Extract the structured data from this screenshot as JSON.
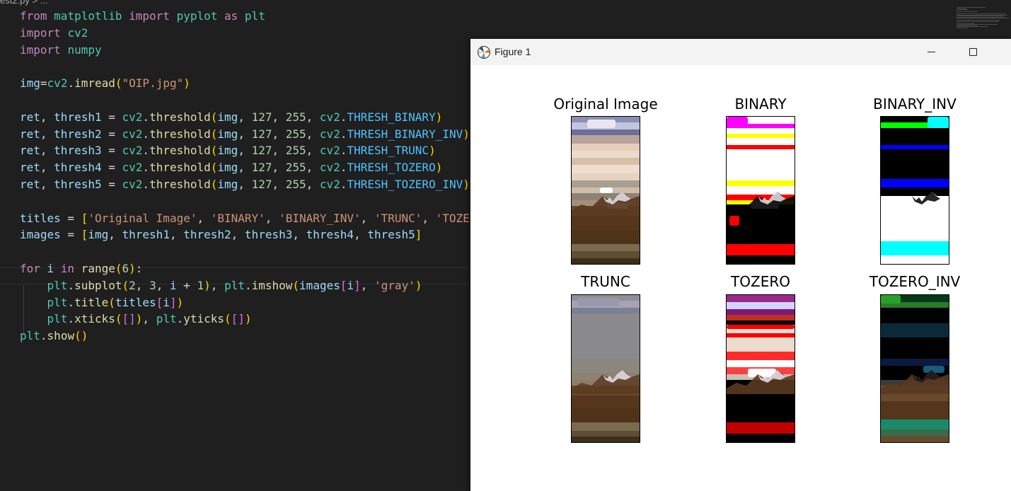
{
  "editor": {
    "breadcrumb": "est2.py > ...",
    "lines": [
      [
        [
          "kw",
          "from "
        ],
        [
          "mod",
          "matplotlib "
        ],
        [
          "kw",
          "import "
        ],
        [
          "mod",
          "pyplot "
        ],
        [
          "kw",
          "as "
        ],
        [
          "mod",
          "plt"
        ]
      ],
      [
        [
          "kw",
          "import "
        ],
        [
          "mod",
          "cv2"
        ]
      ],
      [
        [
          "kw",
          "import "
        ],
        [
          "mod",
          "numpy"
        ]
      ],
      [],
      [
        [
          "var",
          "img"
        ],
        [
          "plain",
          "="
        ],
        [
          "mod",
          "cv2"
        ],
        [
          "plain",
          "."
        ],
        [
          "fn",
          "imread"
        ],
        [
          "br1",
          "("
        ],
        [
          "str",
          "\"OIP.jpg\""
        ],
        [
          "br1",
          ")"
        ]
      ],
      [],
      [
        [
          "var",
          "ret"
        ],
        [
          "plain",
          ", "
        ],
        [
          "var",
          "thresh1"
        ],
        [
          "plain",
          " = "
        ],
        [
          "mod",
          "cv2"
        ],
        [
          "plain",
          "."
        ],
        [
          "fn",
          "threshold"
        ],
        [
          "br1",
          "("
        ],
        [
          "var",
          "img"
        ],
        [
          "plain",
          ", "
        ],
        [
          "num",
          "127"
        ],
        [
          "plain",
          ", "
        ],
        [
          "num",
          "255"
        ],
        [
          "plain",
          ", "
        ],
        [
          "mod",
          "cv2"
        ],
        [
          "plain",
          "."
        ],
        [
          "const",
          "THRESH_BINARY"
        ],
        [
          "br1",
          ")"
        ]
      ],
      [
        [
          "var",
          "ret"
        ],
        [
          "plain",
          ", "
        ],
        [
          "var",
          "thresh2"
        ],
        [
          "plain",
          " = "
        ],
        [
          "mod",
          "cv2"
        ],
        [
          "plain",
          "."
        ],
        [
          "fn",
          "threshold"
        ],
        [
          "br1",
          "("
        ],
        [
          "var",
          "img"
        ],
        [
          "plain",
          ", "
        ],
        [
          "num",
          "127"
        ],
        [
          "plain",
          ", "
        ],
        [
          "num",
          "255"
        ],
        [
          "plain",
          ", "
        ],
        [
          "mod",
          "cv2"
        ],
        [
          "plain",
          "."
        ],
        [
          "const",
          "THRESH_BINARY_INV"
        ],
        [
          "br1",
          ")"
        ]
      ],
      [
        [
          "var",
          "ret"
        ],
        [
          "plain",
          ", "
        ],
        [
          "var",
          "thresh3"
        ],
        [
          "plain",
          " = "
        ],
        [
          "mod",
          "cv2"
        ],
        [
          "plain",
          "."
        ],
        [
          "fn",
          "threshold"
        ],
        [
          "br1",
          "("
        ],
        [
          "var",
          "img"
        ],
        [
          "plain",
          ", "
        ],
        [
          "num",
          "127"
        ],
        [
          "plain",
          ", "
        ],
        [
          "num",
          "255"
        ],
        [
          "plain",
          ", "
        ],
        [
          "mod",
          "cv2"
        ],
        [
          "plain",
          "."
        ],
        [
          "const",
          "THRESH_TRUNC"
        ],
        [
          "br1",
          ")"
        ]
      ],
      [
        [
          "var",
          "ret"
        ],
        [
          "plain",
          ", "
        ],
        [
          "var",
          "thresh4"
        ],
        [
          "plain",
          " = "
        ],
        [
          "mod",
          "cv2"
        ],
        [
          "plain",
          "."
        ],
        [
          "fn",
          "threshold"
        ],
        [
          "br1",
          "("
        ],
        [
          "var",
          "img"
        ],
        [
          "plain",
          ", "
        ],
        [
          "num",
          "127"
        ],
        [
          "plain",
          ", "
        ],
        [
          "num",
          "255"
        ],
        [
          "plain",
          ", "
        ],
        [
          "mod",
          "cv2"
        ],
        [
          "plain",
          "."
        ],
        [
          "const",
          "THRESH_TOZERO"
        ],
        [
          "br1",
          ")"
        ]
      ],
      [
        [
          "var",
          "ret"
        ],
        [
          "plain",
          ", "
        ],
        [
          "var",
          "thresh5"
        ],
        [
          "plain",
          " = "
        ],
        [
          "mod",
          "cv2"
        ],
        [
          "plain",
          "."
        ],
        [
          "fn",
          "threshold"
        ],
        [
          "br1",
          "("
        ],
        [
          "var",
          "img"
        ],
        [
          "plain",
          ", "
        ],
        [
          "num",
          "127"
        ],
        [
          "plain",
          ", "
        ],
        [
          "num",
          "255"
        ],
        [
          "plain",
          ", "
        ],
        [
          "mod",
          "cv2"
        ],
        [
          "plain",
          "."
        ],
        [
          "const",
          "THRESH_TOZERO_INV"
        ],
        [
          "br1",
          ")"
        ]
      ],
      [],
      [
        [
          "var",
          "titles"
        ],
        [
          "plain",
          " = "
        ],
        [
          "br1",
          "["
        ],
        [
          "str",
          "'Original Image'"
        ],
        [
          "plain",
          ", "
        ],
        [
          "str",
          "'BINARY'"
        ],
        [
          "plain",
          ", "
        ],
        [
          "str",
          "'BINARY_INV'"
        ],
        [
          "plain",
          ", "
        ],
        [
          "str",
          "'TRUNC'"
        ],
        [
          "plain",
          ", "
        ],
        [
          "str",
          "'TOZE"
        ]
      ],
      [
        [
          "var",
          "images"
        ],
        [
          "plain",
          " = "
        ],
        [
          "br1",
          "["
        ],
        [
          "var",
          "img"
        ],
        [
          "plain",
          ", "
        ],
        [
          "var",
          "thresh1"
        ],
        [
          "plain",
          ", "
        ],
        [
          "var",
          "thresh2"
        ],
        [
          "plain",
          ", "
        ],
        [
          "var",
          "thresh3"
        ],
        [
          "plain",
          ", "
        ],
        [
          "var",
          "thresh4"
        ],
        [
          "plain",
          ", "
        ],
        [
          "var",
          "thresh5"
        ],
        [
          "br1",
          "]"
        ]
      ],
      [],
      [
        [
          "kw",
          "for "
        ],
        [
          "var",
          "i "
        ],
        [
          "kw",
          "in "
        ],
        [
          "fn",
          "range"
        ],
        [
          "br1",
          "("
        ],
        [
          "num",
          "6"
        ],
        [
          "br1",
          ")"
        ],
        [
          "plain",
          ":"
        ]
      ],
      [
        [
          "plain",
          "    "
        ],
        [
          "mod",
          "plt"
        ],
        [
          "plain",
          "."
        ],
        [
          "fn",
          "subplot"
        ],
        [
          "br1",
          "("
        ],
        [
          "num",
          "2"
        ],
        [
          "plain",
          ", "
        ],
        [
          "num",
          "3"
        ],
        [
          "plain",
          ", "
        ],
        [
          "var",
          "i"
        ],
        [
          "plain",
          " + "
        ],
        [
          "num",
          "1"
        ],
        [
          "br1",
          ")"
        ],
        [
          "plain",
          ", "
        ],
        [
          "mod",
          "plt"
        ],
        [
          "plain",
          "."
        ],
        [
          "fn",
          "imshow"
        ],
        [
          "br1",
          "("
        ],
        [
          "var",
          "images"
        ],
        [
          "br2",
          "["
        ],
        [
          "var",
          "i"
        ],
        [
          "br2",
          "]"
        ],
        [
          "plain",
          ", "
        ],
        [
          "str",
          "'gray'"
        ],
        [
          "br1",
          ")"
        ]
      ],
      [
        [
          "plain",
          "    "
        ],
        [
          "mod",
          "plt"
        ],
        [
          "plain",
          "."
        ],
        [
          "fn",
          "title"
        ],
        [
          "br1",
          "("
        ],
        [
          "var",
          "titles"
        ],
        [
          "br2",
          "["
        ],
        [
          "var",
          "i"
        ],
        [
          "br2",
          "]"
        ],
        [
          "br1",
          ")"
        ]
      ],
      [
        [
          "plain",
          "    "
        ],
        [
          "mod",
          "plt"
        ],
        [
          "plain",
          "."
        ],
        [
          "fn",
          "xticks"
        ],
        [
          "br1",
          "("
        ],
        [
          "br2",
          "[]"
        ],
        [
          "br1",
          ")"
        ],
        [
          "plain",
          ", "
        ],
        [
          "mod",
          "plt"
        ],
        [
          "plain",
          "."
        ],
        [
          "fn",
          "yticks"
        ],
        [
          "br1",
          "("
        ],
        [
          "br2",
          "[]"
        ],
        [
          "br1",
          ")"
        ]
      ],
      [
        [
          "mod",
          "plt"
        ],
        [
          "plain",
          "."
        ],
        [
          "fn",
          "show"
        ],
        [
          "br1",
          "()"
        ]
      ]
    ],
    "colors": {
      "kw": "#c586c0",
      "mod": "#4ec9b0",
      "var": "#9cdcfe",
      "fn": "#dcdcaa",
      "str": "#ce9178",
      "num": "#b5cea8",
      "const": "#4fc1ff",
      "bracket": "#ffd700"
    }
  },
  "figure": {
    "title": "Figure 1",
    "icon": "matplotlib-logo-icon",
    "controls": [
      "minimize-icon",
      "maximize-icon"
    ],
    "subplots": [
      {
        "title": "Original Image",
        "variant": "original"
      },
      {
        "title": "BINARY",
        "variant": "binary"
      },
      {
        "title": "BINARY_INV",
        "variant": "binary_inv"
      },
      {
        "title": "TRUNC",
        "variant": "trunc"
      },
      {
        "title": "TOZERO",
        "variant": "tozero"
      },
      {
        "title": "TOZERO_INV",
        "variant": "tozero_inv"
      }
    ]
  }
}
